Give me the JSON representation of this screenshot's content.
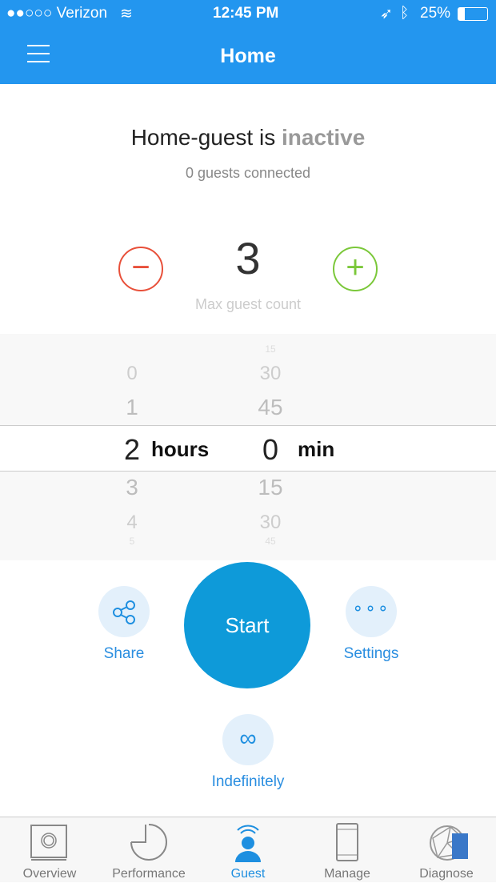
{
  "status_bar": {
    "carrier": "●●○○○ Verizon",
    "time": "12:45 PM",
    "battery": "25%"
  },
  "header": {
    "title": "Home"
  },
  "network": {
    "name": "Home-guest is ",
    "state": "inactive",
    "guests": "0 guests connected"
  },
  "guest_count": {
    "value": "3",
    "label": "Max guest count",
    "minus": "−",
    "plus": "+"
  },
  "picker": {
    "hours": [
      "",
      "0",
      "1",
      "2",
      "3",
      "4",
      "5"
    ],
    "minutes": [
      "15",
      "30",
      "45",
      "0",
      "15",
      "30",
      "45"
    ],
    "hours_unit": "hours",
    "minutes_unit": "min"
  },
  "actions": {
    "share": "Share",
    "start": "Start",
    "settings": "Settings",
    "indefinitely": "Indefinitely"
  },
  "tabs": [
    {
      "label": "Overview"
    },
    {
      "label": "Performance"
    },
    {
      "label": "Guest",
      "active": true
    },
    {
      "label": "Manage"
    },
    {
      "label": "Diagnose"
    }
  ],
  "colors": {
    "accent": "#2396ef",
    "start": "#0e9ad9",
    "minus": "#e8503a",
    "plus": "#7bc83a"
  }
}
